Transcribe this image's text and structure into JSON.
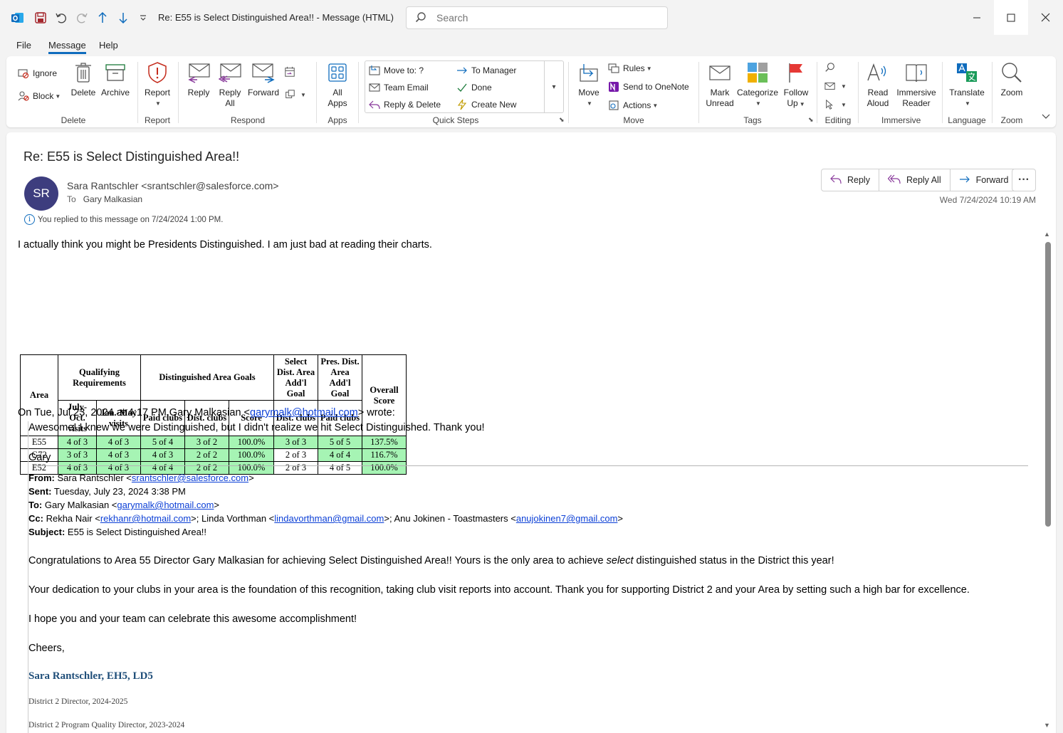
{
  "window": {
    "title": "Re: E55 is Select Distinguished Area!!  -  Message (HTML)",
    "search_placeholder": "Search"
  },
  "menu": {
    "tabs": [
      "File",
      "Message",
      "Help"
    ],
    "active": "Message"
  },
  "ribbon": {
    "delete_group": {
      "label": "Delete",
      "ignore": "Ignore",
      "block": "Block",
      "delete": "Delete",
      "archive": "Archive"
    },
    "report_group": {
      "label": "Report",
      "report": "Report"
    },
    "respond_group": {
      "label": "Respond",
      "reply": "Reply",
      "reply_all_1": "Reply",
      "reply_all_2": "All",
      "forward": "Forward"
    },
    "apps_group": {
      "label": "Apps",
      "all_apps_1": "All",
      "all_apps_2": "Apps"
    },
    "quick_steps": {
      "label": "Quick Steps",
      "items": [
        "Move to: ?",
        "To Manager",
        "Team Email",
        "Done",
        "Reply & Delete",
        "Create New"
      ]
    },
    "move_group": {
      "label": "Move",
      "move": "Move",
      "rules": "Rules",
      "onenote": "Send to OneNote",
      "actions": "Actions"
    },
    "tags_group": {
      "label": "Tags",
      "mark_unread_1": "Mark",
      "mark_unread_2": "Unread",
      "categorize": "Categorize",
      "follow_up_1": "Follow",
      "follow_up_2": "Up"
    },
    "editing_group": {
      "label": "Editing"
    },
    "immersive_group": {
      "label": "Immersive",
      "read_aloud_1": "Read",
      "read_aloud_2": "Aloud",
      "immersive_reader_1": "Immersive",
      "immersive_reader_2": "Reader"
    },
    "language_group": {
      "label": "Language",
      "translate": "Translate"
    },
    "zoom_group": {
      "label": "Zoom",
      "zoom": "Zoom"
    }
  },
  "message": {
    "subject": "Re: E55 is Select Distinguished Area!!",
    "avatar_initials": "SR",
    "sender": "Sara Rantschler <srantschler@salesforce.com>",
    "to_label": "To",
    "to": "Gary Malkasian",
    "replied_note": "You replied to this message on 7/24/2024 1:00 PM.",
    "datetime": "Wed 7/24/2024 10:19 AM",
    "actions": {
      "reply": "Reply",
      "reply_all": "Reply All",
      "forward": "Forward"
    }
  },
  "body": {
    "intro": "I actually think you might be Presidents Distinguished.  I am just bad at reading their charts.",
    "table": {
      "h_area": "Area",
      "h_qual": "Qualifying Requirements",
      "h_goals": "Distinguished Area Goals",
      "h_select": "Select Dist. Area Add'l Goal",
      "h_pres": "Pres. Dist. Area Add'l Goal",
      "h_overall": "Overall Score",
      "sub": [
        "July-Oct. visits",
        "Jan.-May visits",
        "Paid clubs",
        "Dist. clubs",
        "Score",
        "Dist. clubs",
        "Paid clubs"
      ],
      "rows": [
        [
          "E55",
          "4 of 3",
          "4 of 3",
          "5 of 4",
          "3 of 2",
          "100.0%",
          "3 of 3",
          "5 of 5",
          "137.5%"
        ],
        [
          "G72",
          "3 of 3",
          "4 of 3",
          "4 of 3",
          "2 of 2",
          "100.0%",
          "2 of 3",
          "4 of 4",
          "116.7%"
        ],
        [
          "E52",
          "4 of 3",
          "4 of 3",
          "4 of 4",
          "2 of 2",
          "100.0%",
          "2 of 3",
          "4 of 5",
          "100.0%"
        ]
      ]
    },
    "wrote_prefix": "On Tue, Jul 23, 2024 at 4:17 PM Gary Malkasian <",
    "wrote_email": "garymalk@hotmail.com",
    "wrote_suffix": "> wrote:",
    "reply_text": "Awesome!  I knew we were Distinguished, but I didn't realize we hit Select Distinguished.  Thank you!",
    "reply_sig": "Gary",
    "orig": {
      "from_label": "From:",
      "from_name": "Sara Rantschler <",
      "from_email": "srantschler@salesforce.com",
      "from_end": ">",
      "sent_label": "Sent:",
      "sent": "Tuesday, July 23, 2024 3:38 PM",
      "to_label": "To:",
      "to_name": "Gary Malkasian <",
      "to_email": "garymalk@hotmail.com",
      "to_end": ">",
      "cc_label": "Cc:",
      "cc1_name": "Rekha Nair <",
      "cc1_email": "rekhanr@hotmail.com",
      "cc2_name": ">; Linda Vorthman <",
      "cc2_email": "lindavorthman@gmail.com",
      "cc3_name": ">; Anu Jokinen - Toastmasters <",
      "cc3_email": "anujokinen7@gmail.com",
      "cc_end": ">",
      "subject_label": "Subject:",
      "subject": "E55 is Select Distinguished Area!!"
    },
    "para1_a": "Congratulations to Area 55 Director Gary Malkasian for achieving Select Distinguished Area!!  Yours is the only area to achieve ",
    "para1_em": "select",
    "para1_b": " distinguished status in the District this year!",
    "para2": "Your dedication to your clubs in your area is the foundation of this recognition, taking club visit reports into account.  Thank you for supporting District 2 and your Area by setting such a high bar for excellence.",
    "para3": "I hope you and your team can celebrate this awesome accomplishment!",
    "closing": "Cheers,",
    "sig_name": "Sara Rantschler, EH5, LD5",
    "sig_line1": "District 2 Director, 2024-2025",
    "sig_line2": "District 2 Program  Quality Director, 2023-2024"
  }
}
